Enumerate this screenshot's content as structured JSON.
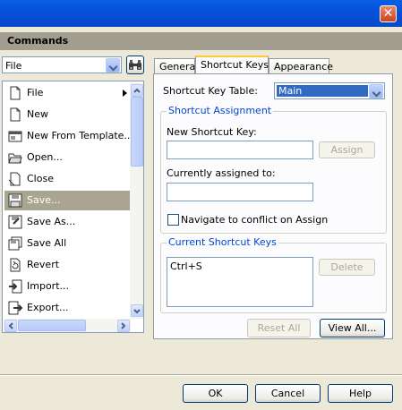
{
  "window": {
    "close_symbol": "✕"
  },
  "panel": {
    "title": "Commands"
  },
  "category": {
    "value": "File"
  },
  "commands": [
    {
      "label": "File",
      "icon": "file-icon",
      "submenu": true
    },
    {
      "label": "New",
      "icon": "new-document-icon"
    },
    {
      "label": "New From Template...",
      "icon": "template-icon"
    },
    {
      "label": "Open...",
      "icon": "open-folder-icon"
    },
    {
      "label": "Close",
      "icon": "close-document-icon"
    },
    {
      "label": "Save...",
      "icon": "save-icon",
      "selected": true
    },
    {
      "label": "Save As...",
      "icon": "save-as-icon"
    },
    {
      "label": "Save All",
      "icon": "save-all-icon"
    },
    {
      "label": "Revert",
      "icon": "revert-icon"
    },
    {
      "label": "Import...",
      "icon": "import-icon"
    },
    {
      "label": "Export...",
      "icon": "export-icon"
    }
  ],
  "tabs": [
    {
      "label": "General"
    },
    {
      "label": "Shortcut Keys",
      "active": true
    },
    {
      "label": "Appearance"
    }
  ],
  "shortcut_table": {
    "label": "Shortcut Key Table:",
    "value": "Main"
  },
  "assignment": {
    "title": "Shortcut Assignment",
    "new_key_label": "New Shortcut Key:",
    "new_key_value": "",
    "assign_label": "Assign",
    "currently_label": "Currently assigned to:",
    "currently_value": "",
    "navigate_label": "Navigate to conflict on Assign",
    "navigate_checked": false
  },
  "current_keys": {
    "title": "Current Shortcut Keys",
    "items": [
      "Ctrl+S"
    ],
    "delete_label": "Delete"
  },
  "actions": {
    "reset_all": "Reset All",
    "view_all": "View All..."
  },
  "footer": {
    "ok": "OK",
    "cancel": "Cancel",
    "help": "Help"
  },
  "colors": {
    "title_bar": "#0550d8",
    "selection": "#a9a591",
    "group_title": "#0046d5",
    "dialog_bg": "#ece9d8"
  }
}
